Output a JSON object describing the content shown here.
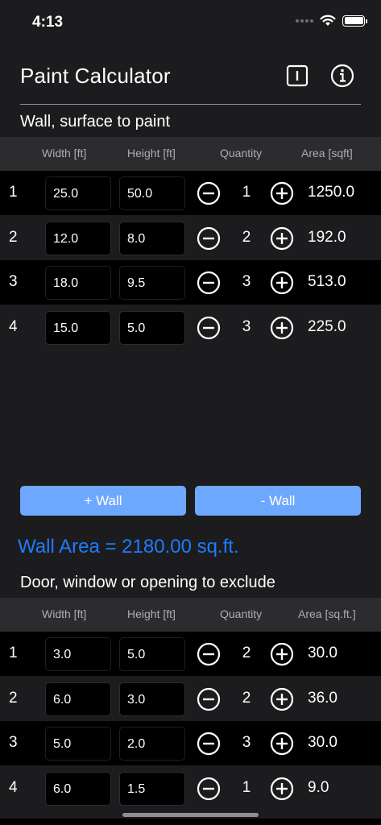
{
  "status": {
    "time": "4:13"
  },
  "nav": {
    "title": "Paint Calculator"
  },
  "walls": {
    "title": "Wall, surface to paint",
    "headers": {
      "width": "Width [ft]",
      "height": "Height [ft]",
      "quantity": "Quantity",
      "area": "Area [sqft]"
    },
    "rows": [
      {
        "index": "1",
        "width": "25.0",
        "height": "50.0",
        "quantity": "1",
        "area": "1250.0"
      },
      {
        "index": "2",
        "width": "12.0",
        "height": "8.0",
        "quantity": "2",
        "area": "192.0"
      },
      {
        "index": "3",
        "width": "18.0",
        "height": "9.5",
        "quantity": "3",
        "area": "513.0"
      },
      {
        "index": "4",
        "width": "15.0",
        "height": "5.0",
        "quantity": "3",
        "area": "225.0"
      }
    ],
    "add_label": "+ Wall",
    "remove_label": "- Wall",
    "total": "Wall Area = 2180.00 sq.ft."
  },
  "openings": {
    "title": "Door, window or opening to exclude",
    "headers": {
      "width": "Width [ft]",
      "height": "Height [ft]",
      "quantity": "Quantity",
      "area": "Area [sq.ft.]"
    },
    "rows": [
      {
        "index": "1",
        "width": "3.0",
        "height": "5.0",
        "quantity": "2",
        "area": "30.0"
      },
      {
        "index": "2",
        "width": "6.0",
        "height": "3.0",
        "quantity": "2",
        "area": "36.0"
      },
      {
        "index": "3",
        "width": "5.0",
        "height": "2.0",
        "quantity": "3",
        "area": "30.0"
      },
      {
        "index": "4",
        "width": "6.0",
        "height": "1.5",
        "quantity": "1",
        "area": "9.0"
      }
    ]
  },
  "icons": {
    "wifi": "wifi-icon",
    "battery": "battery-icon",
    "info_square": "info-square-icon",
    "info_circle": "info-circle-icon",
    "minus": "minus-circle-icon",
    "plus": "plus-circle-icon"
  },
  "colors": {
    "background": "#1c1c1e",
    "row_dark": "#000000",
    "header_bg": "#2c2c2e",
    "button": "#6ea8fe",
    "total_text": "#1e7bff"
  }
}
